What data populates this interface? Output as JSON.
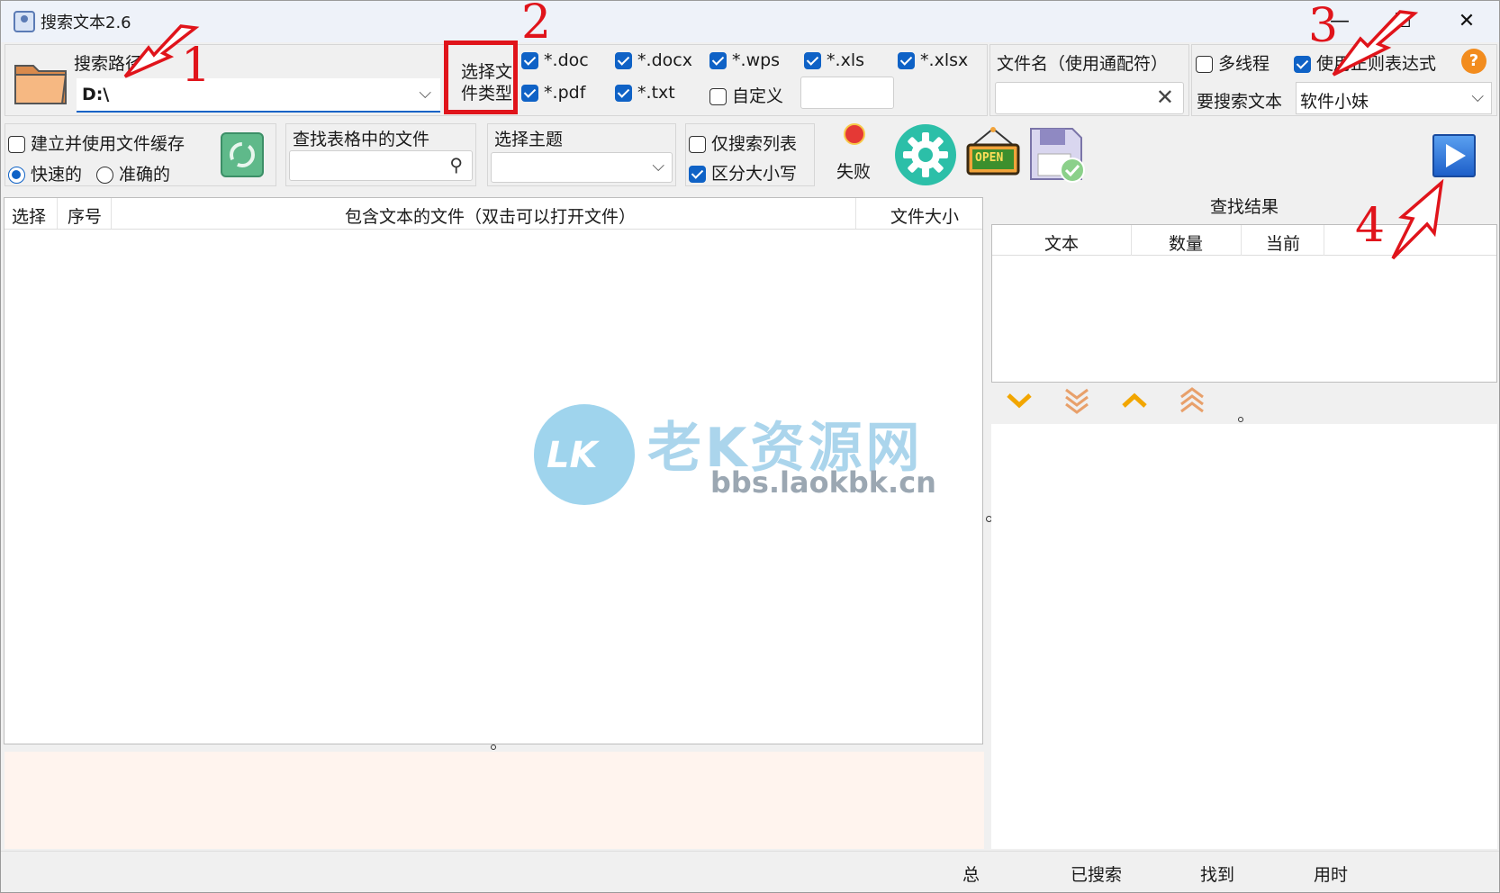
{
  "window": {
    "title": "搜索文本2.6",
    "minimize": "—",
    "maximize": "☐",
    "close": "✕"
  },
  "path": {
    "label": "搜索路径",
    "value": "D:\\"
  },
  "file_type": {
    "label_line1": "选择文",
    "label_line2": "件类型",
    "types": [
      {
        "label": "*.doc",
        "checked": true
      },
      {
        "label": "*.docx",
        "checked": true
      },
      {
        "label": "*.wps",
        "checked": true
      },
      {
        "label": "*.xls",
        "checked": true
      },
      {
        "label": "*.xlsx",
        "checked": true
      },
      {
        "label": "*.pdf",
        "checked": true
      },
      {
        "label": "*.txt",
        "checked": true
      },
      {
        "label": "自定义",
        "checked": false
      }
    ]
  },
  "filename": {
    "label": "文件名（使用通配符）",
    "value": ""
  },
  "options": {
    "multithread": {
      "label": "多线程",
      "checked": false
    },
    "regex": {
      "label": "使用正则表达式",
      "checked": true
    },
    "search_text_label": "要搜索文本",
    "search_text_value": "软件小妹"
  },
  "cache": {
    "label": "建立并使用文件缓存",
    "checked": false,
    "fast": "快速的",
    "accurate": "准确的"
  },
  "table_search": {
    "label": "查找表格中的文件",
    "value": ""
  },
  "theme": {
    "label": "选择主题",
    "value": ""
  },
  "filters": {
    "list_only": {
      "label": "仅搜索列表",
      "checked": false
    },
    "case": {
      "label": "区分大小写",
      "checked": true
    }
  },
  "status_fail": "失败",
  "open_icon_text": "OPEN",
  "file_table": {
    "columns": [
      "选择",
      "序号",
      "包含文本的文件（双击可以打开文件）",
      "文件大小"
    ],
    "rows": []
  },
  "results": {
    "title": "查找结果",
    "columns": [
      "文本",
      "数量",
      "当前"
    ]
  },
  "statusbar": {
    "total": "总",
    "searched": "已搜索",
    "found": "找到",
    "time": "用时"
  },
  "annotations": [
    "1",
    "2",
    "3",
    "4"
  ],
  "watermark": {
    "brand": "老K资源网",
    "url": "bbs.laokbk.cn",
    "logo": "LK"
  },
  "colors": {
    "accent": "#0f62c6",
    "annotation_red": "#e0141b",
    "log_bg": "#fff4ee",
    "gear": "#2cbfa8"
  }
}
